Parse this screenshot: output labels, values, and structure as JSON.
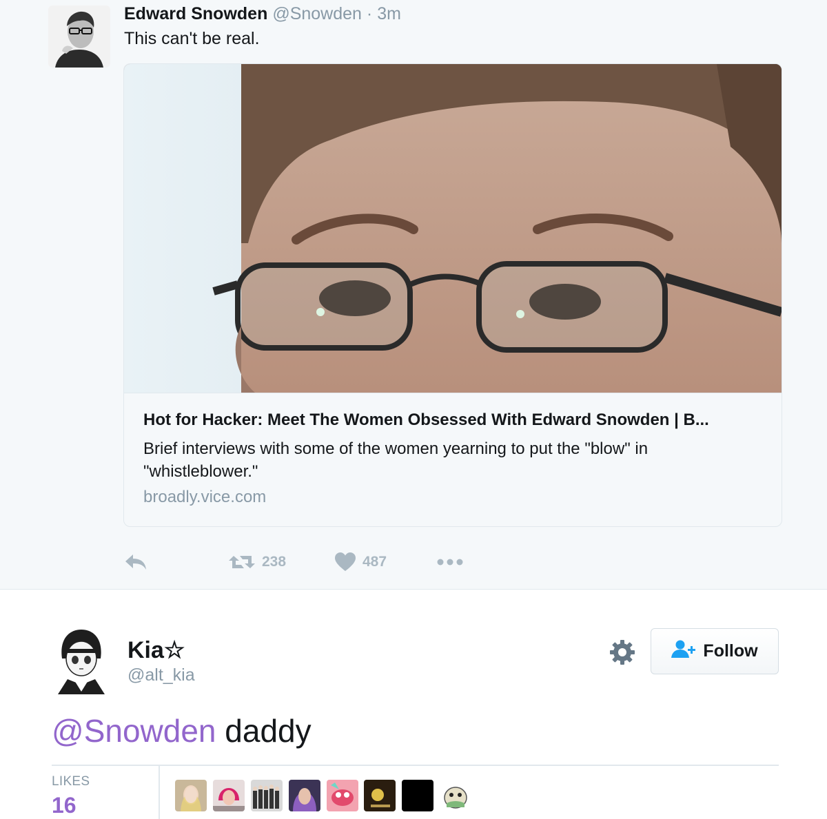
{
  "tweet": {
    "author_name": "Edward Snowden",
    "author_handle": "@Snowden",
    "separator": "·",
    "time": "3m",
    "text": "This can't be real.",
    "card": {
      "title": "Hot for Hacker: Meet The Women Obsessed With Edward Snowden | B...",
      "description": "Brief interviews with some of the women yearning to put the \"blow\" in \"whistleblower.\"",
      "domain": "broadly.vice.com"
    },
    "actions": {
      "reply_icon": "reply-icon",
      "retweet_icon": "retweet-icon",
      "retweet_count": "238",
      "like_icon": "heart-icon",
      "like_count": "487",
      "more_icon": "more-icon"
    }
  },
  "reply": {
    "author_name": "Kia☆",
    "author_handle": "@alt_kia",
    "follow_label": "Follow",
    "mention": "@Snowden",
    "text": " daddy",
    "likes_label": "LIKES",
    "likes_count": "16"
  },
  "colors": {
    "mention": "#9266cc",
    "muted": "#8899a6",
    "action_grey": "#aab8c2",
    "follow_icon": "#1da1f2"
  }
}
